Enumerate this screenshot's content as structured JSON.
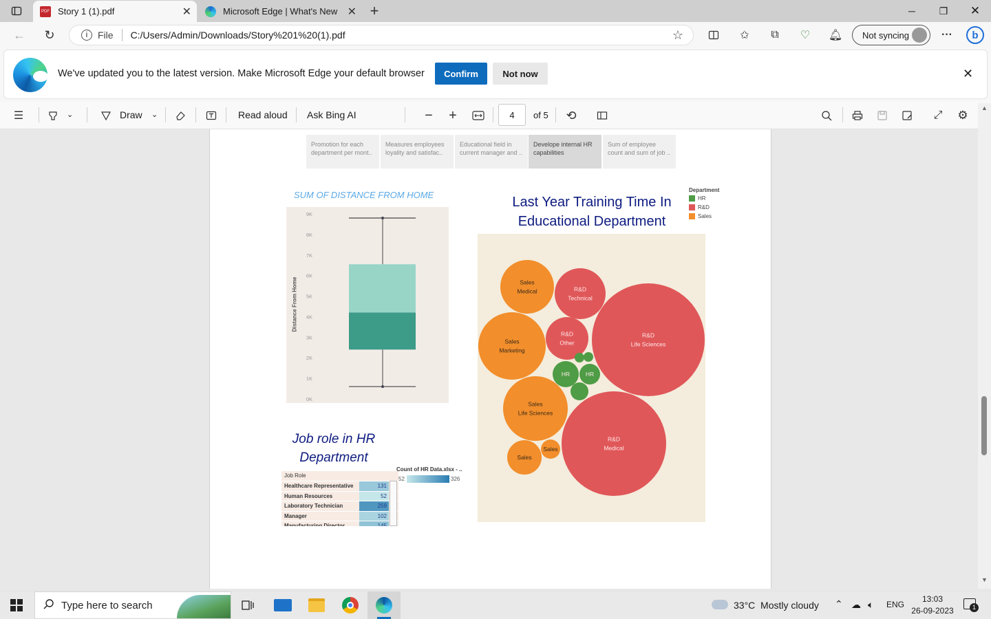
{
  "browser": {
    "tabs": [
      {
        "title": "Story 1 (1).pdf",
        "icon": "pdf-icon"
      },
      {
        "title": "Microsoft Edge | What's New",
        "icon": "edge-icon"
      }
    ],
    "address": {
      "scheme_label": "File",
      "url": "C:/Users/Admin/Downloads/Story%201%20(1).pdf"
    },
    "profile": {
      "label": "Not syncing"
    }
  },
  "notification": {
    "message": "We've updated you to the latest version. Make Microsoft Edge your default browser",
    "confirm_label": "Confirm",
    "dismiss_label": "Not now"
  },
  "pdf_toolbar": {
    "draw_label": "Draw",
    "read_aloud_label": "Read aloud",
    "ask_bing_label": "Ask Bing AI",
    "page_number": "4",
    "page_total": "of 5"
  },
  "story": {
    "tabs": [
      "Promotion for each department per mont..",
      "Measures employees loyality and satisfac..",
      "Educational field in current manager and ..",
      "Develope internal HR capabilities",
      "Sum of employee count  and sum of job .."
    ],
    "active_tab": 3
  },
  "charts": {
    "boxplot_title": "SUM OF DISTANCE FROM HOME",
    "boxplot_ylabel": "Distance From Home",
    "boxplot_ticks": [
      "9K",
      "8K",
      "7K",
      "6K",
      "5K",
      "4K",
      "3K",
      "2K",
      "1K",
      "0K"
    ],
    "bubble_title_line1": "Last Year Training Time In",
    "bubble_title_line2": "Educational Department",
    "legend_title": "Department",
    "legend": [
      {
        "label": "HR",
        "color": "#4e9c45"
      },
      {
        "label": "R&D",
        "color": "#e05759"
      },
      {
        "label": "Sales",
        "color": "#f28e2b"
      }
    ],
    "table_title_line1": "Job role in HR",
    "table_title_line2": "Department",
    "table_header": "Job Role",
    "table_legend_title": "Count of HR Data.xlsx - ..",
    "table_legend_min": "52",
    "table_legend_max": "326",
    "table_rows": [
      {
        "role": "Healthcare Representative",
        "count": "131"
      },
      {
        "role": "Human Resources",
        "count": "52"
      },
      {
        "role": "Laboratory Technician",
        "count": "259"
      },
      {
        "role": "Manager",
        "count": "102"
      },
      {
        "role": "Manufacturing Director",
        "count": "145"
      }
    ]
  },
  "chart_data": [
    {
      "type": "box",
      "title": "SUM OF DISTANCE FROM HOME",
      "ylabel": "Distance From Home",
      "ylim": [
        0,
        9000
      ],
      "whisker_low": 600,
      "q1": 2400,
      "median": 4200,
      "q3": 6550,
      "whisker_high": 8800,
      "grid": false
    },
    {
      "type": "bubble",
      "title": "Last Year Training Time In Educational Department",
      "legend_position": "top-right",
      "bubbles": [
        {
          "department": "Sales",
          "field": "Medical",
          "size": 39
        },
        {
          "department": "R&D",
          "field": "Technical",
          "size": 37
        },
        {
          "department": "R&D",
          "field": "Life Sciences",
          "size": 82
        },
        {
          "department": "Sales",
          "field": "Marketing",
          "size": 49
        },
        {
          "department": "R&D",
          "field": "Other",
          "size": 31
        },
        {
          "department": "HR",
          "field": "",
          "size": 19
        },
        {
          "department": "HR",
          "field": "",
          "size": 15
        },
        {
          "department": "HR",
          "field": "",
          "size": 7
        },
        {
          "department": "HR",
          "field": "",
          "size": 7
        },
        {
          "department": "HR",
          "field": "",
          "size": 13
        },
        {
          "department": "Sales",
          "field": "Life Sciences",
          "size": 47
        },
        {
          "department": "R&D",
          "field": "Medical",
          "size": 76
        },
        {
          "department": "Sales",
          "field": "",
          "size": 25
        },
        {
          "department": "Sales",
          "field": "",
          "size": 14
        }
      ]
    },
    {
      "type": "table",
      "title": "Job role in HR Department",
      "columns": [
        "Job Role",
        "Count"
      ],
      "rows": [
        [
          "Healthcare Representative",
          131
        ],
        [
          "Human Resources",
          52
        ],
        [
          "Laboratory Technician",
          259
        ],
        [
          "Manager",
          102
        ],
        [
          "Manufacturing Director",
          145
        ]
      ],
      "color_range": [
        52,
        326
      ]
    }
  ],
  "taskbar": {
    "search_placeholder": "Type here to search",
    "weather": "33°C  Mostly cloudy",
    "language": "ENG",
    "time": "13:03",
    "date": "26-09-2023",
    "notifications": "1"
  }
}
